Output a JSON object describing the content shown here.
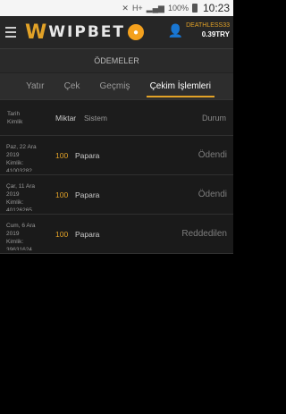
{
  "status_bar": {
    "time": "10:23",
    "battery": "100%",
    "network": "H+",
    "signal_label": "4G"
  },
  "header": {
    "logo_text": "WIPBET",
    "user_name": "DEATHLESS33",
    "user_balance": "0.39TRY"
  },
  "page": {
    "title": "ÖDEMELER"
  },
  "tabs": [
    {
      "label": "Yatır",
      "active": false
    },
    {
      "label": "Çek",
      "active": false
    },
    {
      "label": "Geçmiş",
      "active": false
    },
    {
      "label": "Çekim İşlemleri",
      "active": true
    }
  ],
  "table": {
    "headers": {
      "date": "Tarih",
      "id": "Kimlik",
      "amount": "Miktar",
      "system": "Sistem",
      "status": "Durum"
    },
    "rows": [
      {
        "date_line1": "Paz, 22 Ara",
        "date_line2": "2019",
        "id_label": "Kimlik:",
        "id_value": "41003282",
        "amount": "100",
        "system": "Papara",
        "status": "Ödendi"
      },
      {
        "date_line1": "Çar, 11 Ara",
        "date_line2": "2019",
        "id_label": "Kimlik:",
        "id_value": "40126265",
        "amount": "100",
        "system": "Papara",
        "status": "Ödendi"
      },
      {
        "date_line1": "Cum, 6 Ara",
        "date_line2": "2019",
        "id_label": "Kimlik:",
        "id_value": "39631624",
        "amount": "100",
        "system": "Papara",
        "status": "Reddedilen"
      }
    ]
  },
  "colors": {
    "accent": "#e2a227",
    "background": "#000000",
    "header_bg": "#262626"
  }
}
